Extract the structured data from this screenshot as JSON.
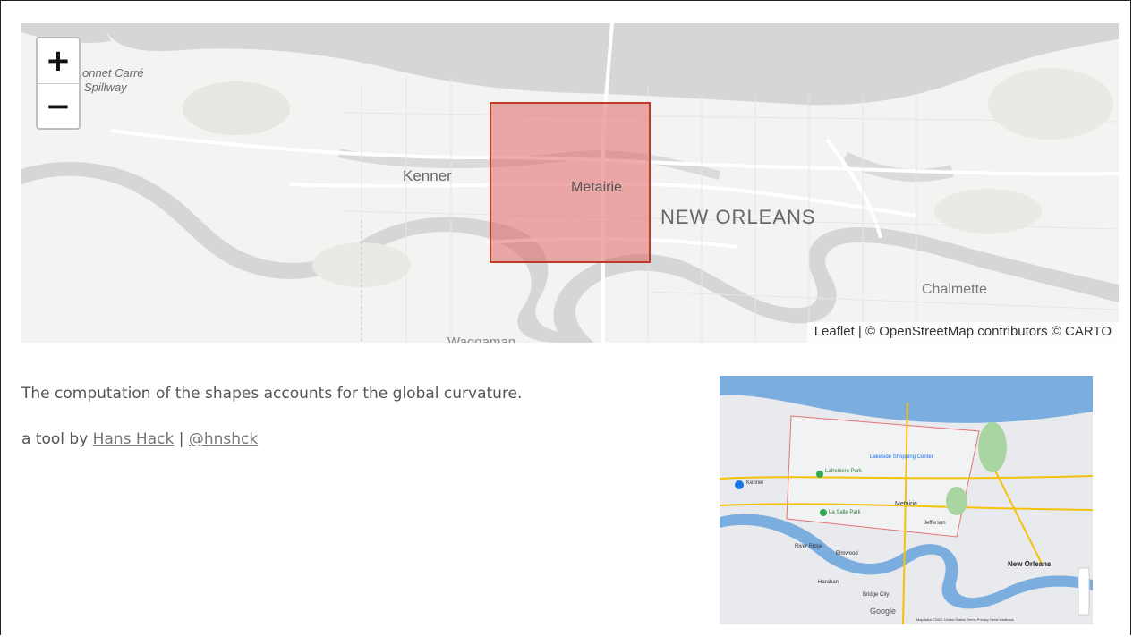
{
  "map": {
    "zoom_in_label": "+",
    "zoom_out_label": "−",
    "labels": {
      "bonnet": "onnet Carré",
      "spillway": "Spillway",
      "kenner": "Kenner",
      "metairie": "Metairie",
      "new_orleans": "NEW ORLEANS",
      "chalmette": "Chalmette",
      "waggaman": "Waggaman"
    },
    "attribution": {
      "leaflet": "Leaflet",
      "sep": " | © ",
      "osm": "OpenStreetMap",
      "rest": " contributors © CARTO"
    },
    "overlay_color": "#e06666"
  },
  "info": {
    "sentence": "The computation of the shapes accounts for the global curvature.",
    "tool_prefix": "a tool by ",
    "author": "Hans Hack",
    "divider": " | ",
    "handle": "@hnshck"
  },
  "thumbnail": {
    "labels": {
      "kenner": "Kenner",
      "metairie": "Metairie",
      "jefferson": "Jefferson",
      "elmwood": "Elmwood",
      "river_ridge": "River Ridge",
      "harahan": "Harahan",
      "new_orleans": "New Orleans",
      "la_salle": "La Salle Park",
      "lafreniere": "Lafreniere Park",
      "lakeside": "Lakeside Shopping Center",
      "bridge_city": "Bridge City",
      "google": "Google",
      "footer": "Map data ©2022   United States   Terms   Privacy   Send feedback"
    }
  }
}
